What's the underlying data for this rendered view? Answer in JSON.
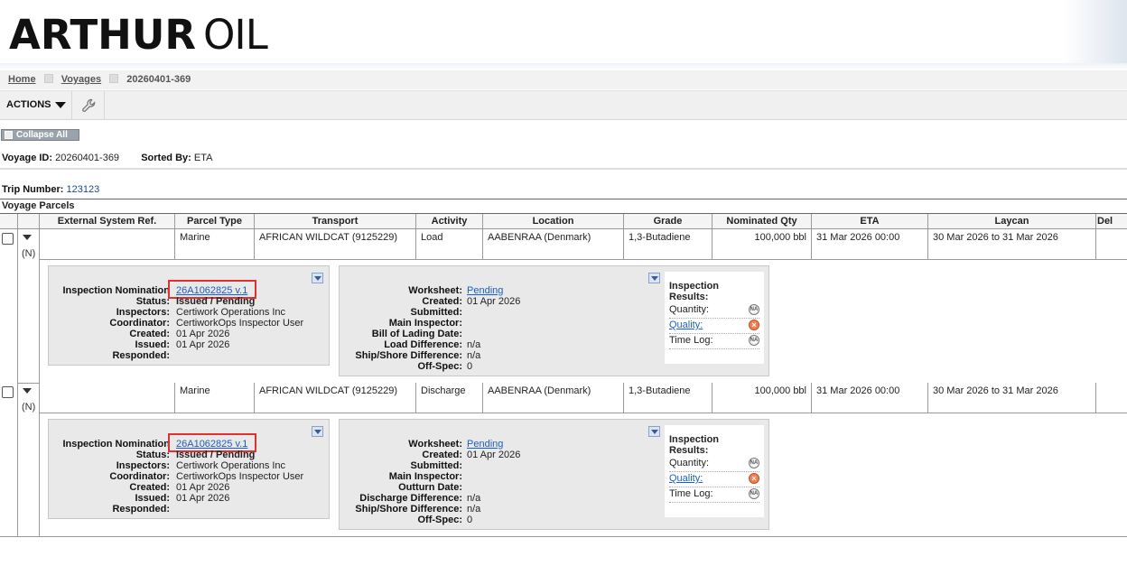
{
  "brand": {
    "name_bold": "ARTHUR",
    "name_light": "OIL"
  },
  "breadcrumb": {
    "home": "Home",
    "voyages": "Voyages",
    "current": "20260401-369"
  },
  "toolbar": {
    "actions_label": "ACTIONS",
    "tool_icon": "wrench-icon"
  },
  "collapse_label": "Collapse All",
  "voyage": {
    "id_label": "Voyage ID:",
    "id_value": "20260401-369",
    "sorted_label": "Sorted By:",
    "sorted_value": "ETA"
  },
  "trip": {
    "label": "Trip Number:",
    "value": "123123"
  },
  "parcels_title": "Voyage Parcels",
  "columns": [
    "External System Ref.",
    "Parcel Type",
    "Transport",
    "Activity",
    "Location",
    "Grade",
    "Nominated Qty",
    "ETA",
    "Laycan",
    "Del"
  ],
  "rows": [
    {
      "flag": "(N)",
      "ext_ref": "",
      "parcel_type": "Marine",
      "transport": "AFRICAN WILDCAT (9125229)",
      "activity": "Load",
      "location": "AABENRAA (Denmark)",
      "grade": "1,3-Butadiene",
      "qty": "100,000 bbl",
      "eta": "31 Mar 2026 00:00",
      "laycan": "30 Mar 2026 to 31 Mar 2026",
      "nomination": {
        "labels": [
          "Inspection Nomination",
          "Status:",
          "Inspectors:",
          "Coordinator:",
          "Created:",
          "Issued:",
          "Responded:"
        ],
        "link": "26A1062825 v.1",
        "values": [
          "Issued / Pending",
          "Certiwork Operations Inc",
          "CertiworkOps Inspector User",
          "01 Apr 2026",
          "01 Apr 2026",
          ""
        ]
      },
      "worksheet": {
        "labels": [
          "Worksheet:",
          "Created:",
          "Submitted:",
          "Main Inspector:",
          "Bill of Lading Date:",
          "Load Difference:",
          "Ship/Shore Difference:",
          "Off-Spec:"
        ],
        "link": "Pending",
        "values": [
          "01 Apr 2026",
          "",
          "",
          "",
          "n/a",
          "n/a",
          "0"
        ]
      },
      "results": {
        "title": "Inspection Results:",
        "items": [
          {
            "label": "Quantity:",
            "link": false,
            "icon": "NA"
          },
          {
            "label": "Quality:",
            "link": true,
            "icon": "fail"
          },
          {
            "label": "Time Log:",
            "link": false,
            "icon": "NA"
          }
        ]
      }
    },
    {
      "flag": "(N)",
      "ext_ref": "",
      "parcel_type": "Marine",
      "transport": "AFRICAN WILDCAT (9125229)",
      "activity": "Discharge",
      "location": "AABENRAA (Denmark)",
      "grade": "1,3-Butadiene",
      "qty": "100,000 bbl",
      "eta": "31 Mar 2026 00:00",
      "laycan": "30 Mar 2026 to 31 Mar 2026",
      "nomination": {
        "labels": [
          "Inspection Nomination",
          "Status:",
          "Inspectors:",
          "Coordinator:",
          "Created:",
          "Issued:",
          "Responded:"
        ],
        "link": "26A1062825 v.1",
        "values": [
          "Issued / Pending",
          "Certiwork Operations Inc",
          "CertiworkOps Inspector User",
          "01 Apr 2026",
          "01 Apr 2026",
          ""
        ]
      },
      "worksheet": {
        "labels": [
          "Worksheet:",
          "Created:",
          "Submitted:",
          "Main Inspector:",
          "Outturn Date:",
          "Discharge Difference:",
          "Ship/Shore Difference:",
          "Off-Spec:"
        ],
        "link": "Pending",
        "values": [
          "01 Apr 2026",
          "",
          "",
          "",
          "n/a",
          "n/a",
          "0"
        ]
      },
      "results": {
        "title": "Inspection Results:",
        "items": [
          {
            "label": "Quantity:",
            "link": false,
            "icon": "NA"
          },
          {
            "label": "Quality:",
            "link": true,
            "icon": "fail"
          },
          {
            "label": "Time Log:",
            "link": false,
            "icon": "NA"
          }
        ]
      }
    }
  ],
  "colors": {
    "link": "#1a5fc0",
    "highlight": "#e03030",
    "fail": "#f08050"
  }
}
